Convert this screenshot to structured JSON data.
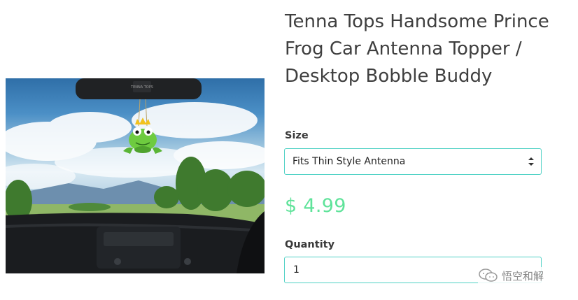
{
  "product": {
    "title": "Tenna Tops Handsome Prince Frog Car Antenna Topper / Desktop Bobble Buddy",
    "size_label": "Size",
    "size_selected": "Fits Thin Style Antenna",
    "price": "$ 4.99",
    "quantity_label": "Quantity",
    "quantity_value": "1"
  },
  "image": {
    "mirror_brand": "TENNA TOPS"
  },
  "watermark": {
    "text": "悟空和解"
  },
  "colors": {
    "accent_border": "#4fd1c5",
    "price": "#5fe39a",
    "heading": "#3f3f3f"
  },
  "icons": {
    "select_arrow": "chevron-up-down-icon",
    "watermark_icon": "wechat-icon"
  }
}
